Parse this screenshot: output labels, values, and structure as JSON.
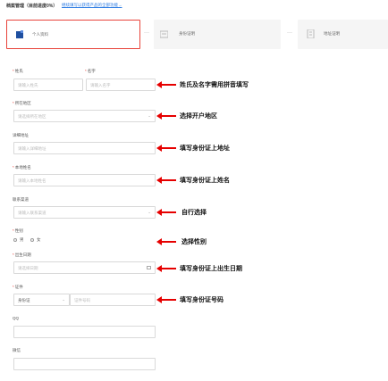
{
  "header": {
    "title": "档案管理（目前进度0%）",
    "link": "继续填写以获得产品的全部功能→"
  },
  "stepper": {
    "steps": [
      {
        "label": "个人资料",
        "icon": "folder-icon"
      },
      {
        "label": "身份证明",
        "icon": "id-card-icon"
      },
      {
        "label": "地址证明",
        "icon": "document-icon"
      }
    ],
    "separator": "···"
  },
  "form": {
    "surname": {
      "label": "姓氏",
      "placeholder": "请输入姓氏"
    },
    "given_name": {
      "label": "名字",
      "placeholder": "请输入名字"
    },
    "region": {
      "label": "所在地区",
      "placeholder": "请选择所在地区"
    },
    "address": {
      "label": "详细地址",
      "placeholder": "请输入详细地址"
    },
    "local_name": {
      "label": "本地姓名",
      "placeholder": "请输入本地姓名"
    },
    "contact_channel": {
      "label": "联系渠道",
      "placeholder": "请输入联系渠道"
    },
    "gender": {
      "label": "性别",
      "options": [
        "男",
        "女"
      ]
    },
    "birth_date": {
      "label": "出生日期",
      "placeholder": "请选择日期"
    },
    "id_doc": {
      "label": "证件",
      "type_value": "身份证",
      "number_placeholder": "证件号码"
    },
    "qq": {
      "label": "QQ"
    },
    "wechat": {
      "label": "微信"
    }
  },
  "annotations": [
    "姓氏及名字需用拼音填写",
    "选择开户地区",
    "填写身份证上地址",
    "填写身份证上姓名",
    "自行选择",
    "选择性别",
    "填写身份证上出生日期",
    "填写身份证号码"
  ],
  "colors": {
    "required": "#e8433a",
    "active_border": "#e8433a",
    "arrow": "#e60000",
    "link": "#2a7ae2"
  }
}
